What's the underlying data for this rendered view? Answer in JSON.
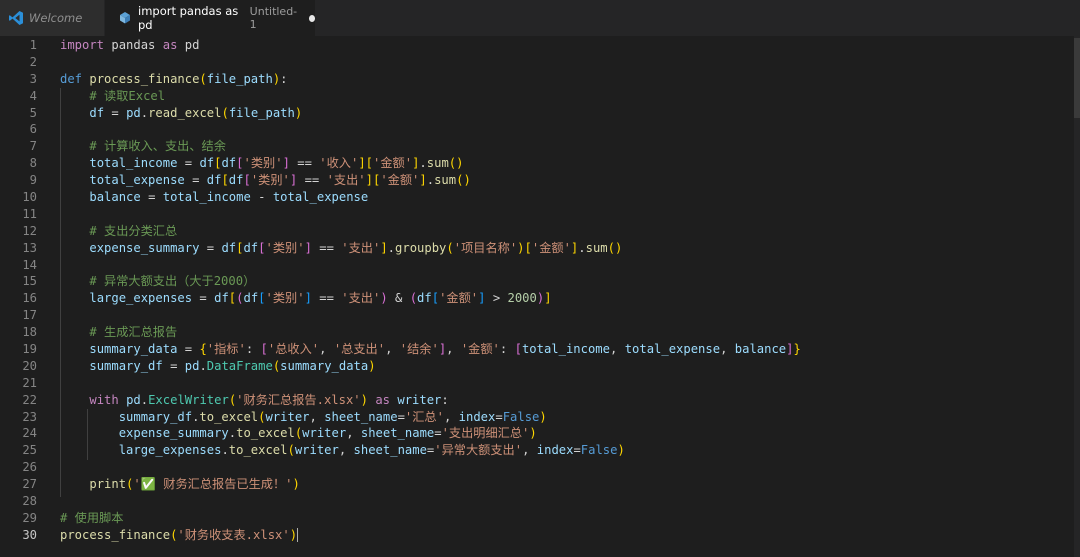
{
  "tabs": [
    {
      "label": "Welcome",
      "icon": "vscode-logo-icon"
    },
    {
      "label": "import pandas as pd",
      "subtitle": "Untitled-1",
      "icon": "python-file-icon",
      "dirty": true
    }
  ],
  "editor": {
    "language": "python",
    "current_line": 30,
    "lines": [
      {
        "n": "1",
        "tokens": [
          [
            "kw",
            "import"
          ],
          [
            "op",
            " pandas "
          ],
          [
            "kw",
            "as"
          ],
          [
            "op",
            " pd"
          ]
        ]
      },
      {
        "n": "2",
        "tokens": []
      },
      {
        "n": "3",
        "tokens": [
          [
            "def",
            "def"
          ],
          [
            "op",
            " "
          ],
          [
            "fn",
            "process_finance"
          ],
          [
            "b1",
            "("
          ],
          [
            "param",
            "file_path"
          ],
          [
            "b1",
            ")"
          ],
          [
            "op",
            ":"
          ]
        ]
      },
      {
        "n": "4",
        "tokens": [
          [
            "op",
            "    "
          ],
          [
            "cm",
            "# 读取Excel"
          ]
        ]
      },
      {
        "n": "5",
        "tokens": [
          [
            "op",
            "    "
          ],
          [
            "var",
            "df"
          ],
          [
            "op",
            " = "
          ],
          [
            "var",
            "pd"
          ],
          [
            "op",
            "."
          ],
          [
            "fn",
            "read_excel"
          ],
          [
            "b1",
            "("
          ],
          [
            "var",
            "file_path"
          ],
          [
            "b1",
            ")"
          ]
        ]
      },
      {
        "n": "6",
        "tokens": []
      },
      {
        "n": "7",
        "tokens": [
          [
            "op",
            "    "
          ],
          [
            "cm",
            "# 计算收入、支出、结余"
          ]
        ]
      },
      {
        "n": "8",
        "tokens": [
          [
            "op",
            "    "
          ],
          [
            "var",
            "total_income"
          ],
          [
            "op",
            " = "
          ],
          [
            "var",
            "df"
          ],
          [
            "b1",
            "["
          ],
          [
            "var",
            "df"
          ],
          [
            "b2",
            "["
          ],
          [
            "str",
            "'类别'"
          ],
          [
            "b2",
            "]"
          ],
          [
            "op",
            " == "
          ],
          [
            "str",
            "'收入'"
          ],
          [
            "b1",
            "]"
          ],
          [
            "b1",
            "["
          ],
          [
            "str",
            "'金额'"
          ],
          [
            "b1",
            "]"
          ],
          [
            "op",
            "."
          ],
          [
            "fn",
            "sum"
          ],
          [
            "b1",
            "()"
          ]
        ]
      },
      {
        "n": "9",
        "tokens": [
          [
            "op",
            "    "
          ],
          [
            "var",
            "total_expense"
          ],
          [
            "op",
            " = "
          ],
          [
            "var",
            "df"
          ],
          [
            "b1",
            "["
          ],
          [
            "var",
            "df"
          ],
          [
            "b2",
            "["
          ],
          [
            "str",
            "'类别'"
          ],
          [
            "b2",
            "]"
          ],
          [
            "op",
            " == "
          ],
          [
            "str",
            "'支出'"
          ],
          [
            "b1",
            "]"
          ],
          [
            "b1",
            "["
          ],
          [
            "str",
            "'金额'"
          ],
          [
            "b1",
            "]"
          ],
          [
            "op",
            "."
          ],
          [
            "fn",
            "sum"
          ],
          [
            "b1",
            "()"
          ]
        ]
      },
      {
        "n": "10",
        "tokens": [
          [
            "op",
            "    "
          ],
          [
            "var",
            "balance"
          ],
          [
            "op",
            " = "
          ],
          [
            "var",
            "total_income"
          ],
          [
            "op",
            " - "
          ],
          [
            "var",
            "total_expense"
          ]
        ]
      },
      {
        "n": "11",
        "tokens": []
      },
      {
        "n": "12",
        "tokens": [
          [
            "op",
            "    "
          ],
          [
            "cm",
            "# 支出分类汇总"
          ]
        ]
      },
      {
        "n": "13",
        "tokens": [
          [
            "op",
            "    "
          ],
          [
            "var",
            "expense_summary"
          ],
          [
            "op",
            " = "
          ],
          [
            "var",
            "df"
          ],
          [
            "b1",
            "["
          ],
          [
            "var",
            "df"
          ],
          [
            "b2",
            "["
          ],
          [
            "str",
            "'类别'"
          ],
          [
            "b2",
            "]"
          ],
          [
            "op",
            " == "
          ],
          [
            "str",
            "'支出'"
          ],
          [
            "b1",
            "]"
          ],
          [
            "op",
            "."
          ],
          [
            "fn",
            "groupby"
          ],
          [
            "b1",
            "("
          ],
          [
            "str",
            "'项目名称'"
          ],
          [
            "b1",
            ")"
          ],
          [
            "b1",
            "["
          ],
          [
            "str",
            "'金额'"
          ],
          [
            "b1",
            "]"
          ],
          [
            "op",
            "."
          ],
          [
            "fn",
            "sum"
          ],
          [
            "b1",
            "()"
          ]
        ]
      },
      {
        "n": "14",
        "tokens": []
      },
      {
        "n": "15",
        "tokens": [
          [
            "op",
            "    "
          ],
          [
            "cm",
            "# 异常大额支出（大于2000）"
          ]
        ]
      },
      {
        "n": "16",
        "tokens": [
          [
            "op",
            "    "
          ],
          [
            "var",
            "large_expenses"
          ],
          [
            "op",
            " = "
          ],
          [
            "var",
            "df"
          ],
          [
            "b1",
            "["
          ],
          [
            "b2",
            "("
          ],
          [
            "var",
            "df"
          ],
          [
            "b3",
            "["
          ],
          [
            "str",
            "'类别'"
          ],
          [
            "b3",
            "]"
          ],
          [
            "op",
            " == "
          ],
          [
            "str",
            "'支出'"
          ],
          [
            "b2",
            ")"
          ],
          [
            "op",
            " & "
          ],
          [
            "b2",
            "("
          ],
          [
            "var",
            "df"
          ],
          [
            "b3",
            "["
          ],
          [
            "str",
            "'金额'"
          ],
          [
            "b3",
            "]"
          ],
          [
            "op",
            " > "
          ],
          [
            "num",
            "2000"
          ],
          [
            "b2",
            ")"
          ],
          [
            "b1",
            "]"
          ]
        ]
      },
      {
        "n": "17",
        "tokens": []
      },
      {
        "n": "18",
        "tokens": [
          [
            "op",
            "    "
          ],
          [
            "cm",
            "# 生成汇总报告"
          ]
        ]
      },
      {
        "n": "19",
        "tokens": [
          [
            "op",
            "    "
          ],
          [
            "var",
            "summary_data"
          ],
          [
            "op",
            " = "
          ],
          [
            "b1",
            "{"
          ],
          [
            "str",
            "'指标'"
          ],
          [
            "op",
            ": "
          ],
          [
            "b2",
            "["
          ],
          [
            "str",
            "'总收入'"
          ],
          [
            "op",
            ", "
          ],
          [
            "str",
            "'总支出'"
          ],
          [
            "op",
            ", "
          ],
          [
            "str",
            "'结余'"
          ],
          [
            "b2",
            "]"
          ],
          [
            "op",
            ", "
          ],
          [
            "str",
            "'金额'"
          ],
          [
            "op",
            ": "
          ],
          [
            "b2",
            "["
          ],
          [
            "var",
            "total_income"
          ],
          [
            "op",
            ", "
          ],
          [
            "var",
            "total_expense"
          ],
          [
            "op",
            ", "
          ],
          [
            "var",
            "balance"
          ],
          [
            "b2",
            "]"
          ],
          [
            "b1",
            "}"
          ]
        ]
      },
      {
        "n": "20",
        "tokens": [
          [
            "op",
            "    "
          ],
          [
            "var",
            "summary_df"
          ],
          [
            "op",
            " = "
          ],
          [
            "var",
            "pd"
          ],
          [
            "op",
            "."
          ],
          [
            "cls",
            "DataFrame"
          ],
          [
            "b1",
            "("
          ],
          [
            "var",
            "summary_data"
          ],
          [
            "b1",
            ")"
          ]
        ]
      },
      {
        "n": "21",
        "tokens": []
      },
      {
        "n": "22",
        "tokens": [
          [
            "op",
            "    "
          ],
          [
            "kw",
            "with"
          ],
          [
            "op",
            " "
          ],
          [
            "var",
            "pd"
          ],
          [
            "op",
            "."
          ],
          [
            "cls",
            "ExcelWriter"
          ],
          [
            "b1",
            "("
          ],
          [
            "str",
            "'财务汇总报告.xlsx'"
          ],
          [
            "b1",
            ")"
          ],
          [
            "op",
            " "
          ],
          [
            "kw",
            "as"
          ],
          [
            "op",
            " "
          ],
          [
            "var",
            "writer"
          ],
          [
            "op",
            ":"
          ]
        ]
      },
      {
        "n": "23",
        "tokens": [
          [
            "op",
            "        "
          ],
          [
            "var",
            "summary_df"
          ],
          [
            "op",
            "."
          ],
          [
            "fn",
            "to_excel"
          ],
          [
            "b1",
            "("
          ],
          [
            "var",
            "writer"
          ],
          [
            "op",
            ", "
          ],
          [
            "param",
            "sheet_name"
          ],
          [
            "op",
            "="
          ],
          [
            "str",
            "'汇总'"
          ],
          [
            "op",
            ", "
          ],
          [
            "param",
            "index"
          ],
          [
            "op",
            "="
          ],
          [
            "kwc",
            "False"
          ],
          [
            "b1",
            ")"
          ]
        ]
      },
      {
        "n": "24",
        "tokens": [
          [
            "op",
            "        "
          ],
          [
            "var",
            "expense_summary"
          ],
          [
            "op",
            "."
          ],
          [
            "fn",
            "to_excel"
          ],
          [
            "b1",
            "("
          ],
          [
            "var",
            "writer"
          ],
          [
            "op",
            ", "
          ],
          [
            "param",
            "sheet_name"
          ],
          [
            "op",
            "="
          ],
          [
            "str",
            "'支出明细汇总'"
          ],
          [
            "b1",
            ")"
          ]
        ]
      },
      {
        "n": "25",
        "tokens": [
          [
            "op",
            "        "
          ],
          [
            "var",
            "large_expenses"
          ],
          [
            "op",
            "."
          ],
          [
            "fn",
            "to_excel"
          ],
          [
            "b1",
            "("
          ],
          [
            "var",
            "writer"
          ],
          [
            "op",
            ", "
          ],
          [
            "param",
            "sheet_name"
          ],
          [
            "op",
            "="
          ],
          [
            "str",
            "'异常大额支出'"
          ],
          [
            "op",
            ", "
          ],
          [
            "param",
            "index"
          ],
          [
            "op",
            "="
          ],
          [
            "kwc",
            "False"
          ],
          [
            "b1",
            ")"
          ]
        ]
      },
      {
        "n": "26",
        "tokens": []
      },
      {
        "n": "27",
        "tokens": [
          [
            "op",
            "    "
          ],
          [
            "fn",
            "print"
          ],
          [
            "b1",
            "("
          ],
          [
            "str",
            "'"
          ],
          [
            "emoji",
            "✅"
          ],
          [
            "str",
            " 财务汇总报告已生成！'"
          ],
          [
            "b1",
            ")"
          ]
        ]
      },
      {
        "n": "28",
        "tokens": []
      },
      {
        "n": "29",
        "tokens": [
          [
            "cm",
            "# 使用脚本"
          ]
        ]
      },
      {
        "n": "30",
        "tokens": [
          [
            "fn",
            "process_finance"
          ],
          [
            "b1",
            "("
          ],
          [
            "str",
            "'财务收支表.xlsx'"
          ],
          [
            "b1",
            ")"
          ]
        ]
      }
    ]
  }
}
